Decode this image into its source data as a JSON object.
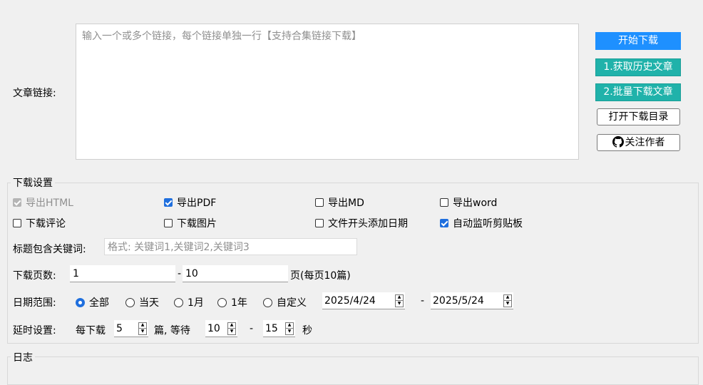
{
  "link_section": {
    "label": "文章链接:",
    "placeholder": "输入一个或多个链接，每个链接单独一行【支持合集链接下载】"
  },
  "buttons": {
    "start": "开始下载",
    "history": "1.获取历史文章",
    "batch": "2.批量下载文章",
    "open_dir": "打开下载目录",
    "follow": "关注作者"
  },
  "settings": {
    "title": "下载设置",
    "options": [
      {
        "label": "导出HTML",
        "checked": true,
        "disabled": true
      },
      {
        "label": "导出PDF",
        "checked": true,
        "disabled": false
      },
      {
        "label": "导出MD",
        "checked": false,
        "disabled": false
      },
      {
        "label": "导出word",
        "checked": false,
        "disabled": false
      },
      {
        "label": "下载评论",
        "checked": false,
        "disabled": false
      },
      {
        "label": "下载图片",
        "checked": false,
        "disabled": false
      },
      {
        "label": "文件开头添加日期",
        "checked": false,
        "disabled": false
      },
      {
        "label": "自动监听剪贴板",
        "checked": true,
        "disabled": false
      }
    ],
    "keyword": {
      "label": "标题包含关键词:",
      "placeholder": "格式: 关键词1,关键词2,关键词3"
    },
    "pages": {
      "label": "下载页数:",
      "from": "1",
      "dash": "-",
      "to": "10",
      "suffix": "页(每页10篇)"
    },
    "date_range": {
      "label": "日期范围:",
      "options": [
        "全部",
        "当天",
        "1月",
        "1年",
        "自定义"
      ],
      "selected": 0,
      "start": "2025/4/24",
      "dash": "-",
      "end": "2025/5/24"
    },
    "delay": {
      "label": "延时设置:",
      "per_label": "每下载",
      "per_value": "5",
      "unit_text": "篇, 等待",
      "min": "10",
      "dash": "-",
      "max": "15",
      "sec": "秒"
    }
  },
  "log": {
    "title": "日志"
  },
  "colors": {
    "accent_blue": "#1e90ff",
    "accent_teal": "#20b2aa",
    "checkbox_blue": "#1f6fde"
  }
}
